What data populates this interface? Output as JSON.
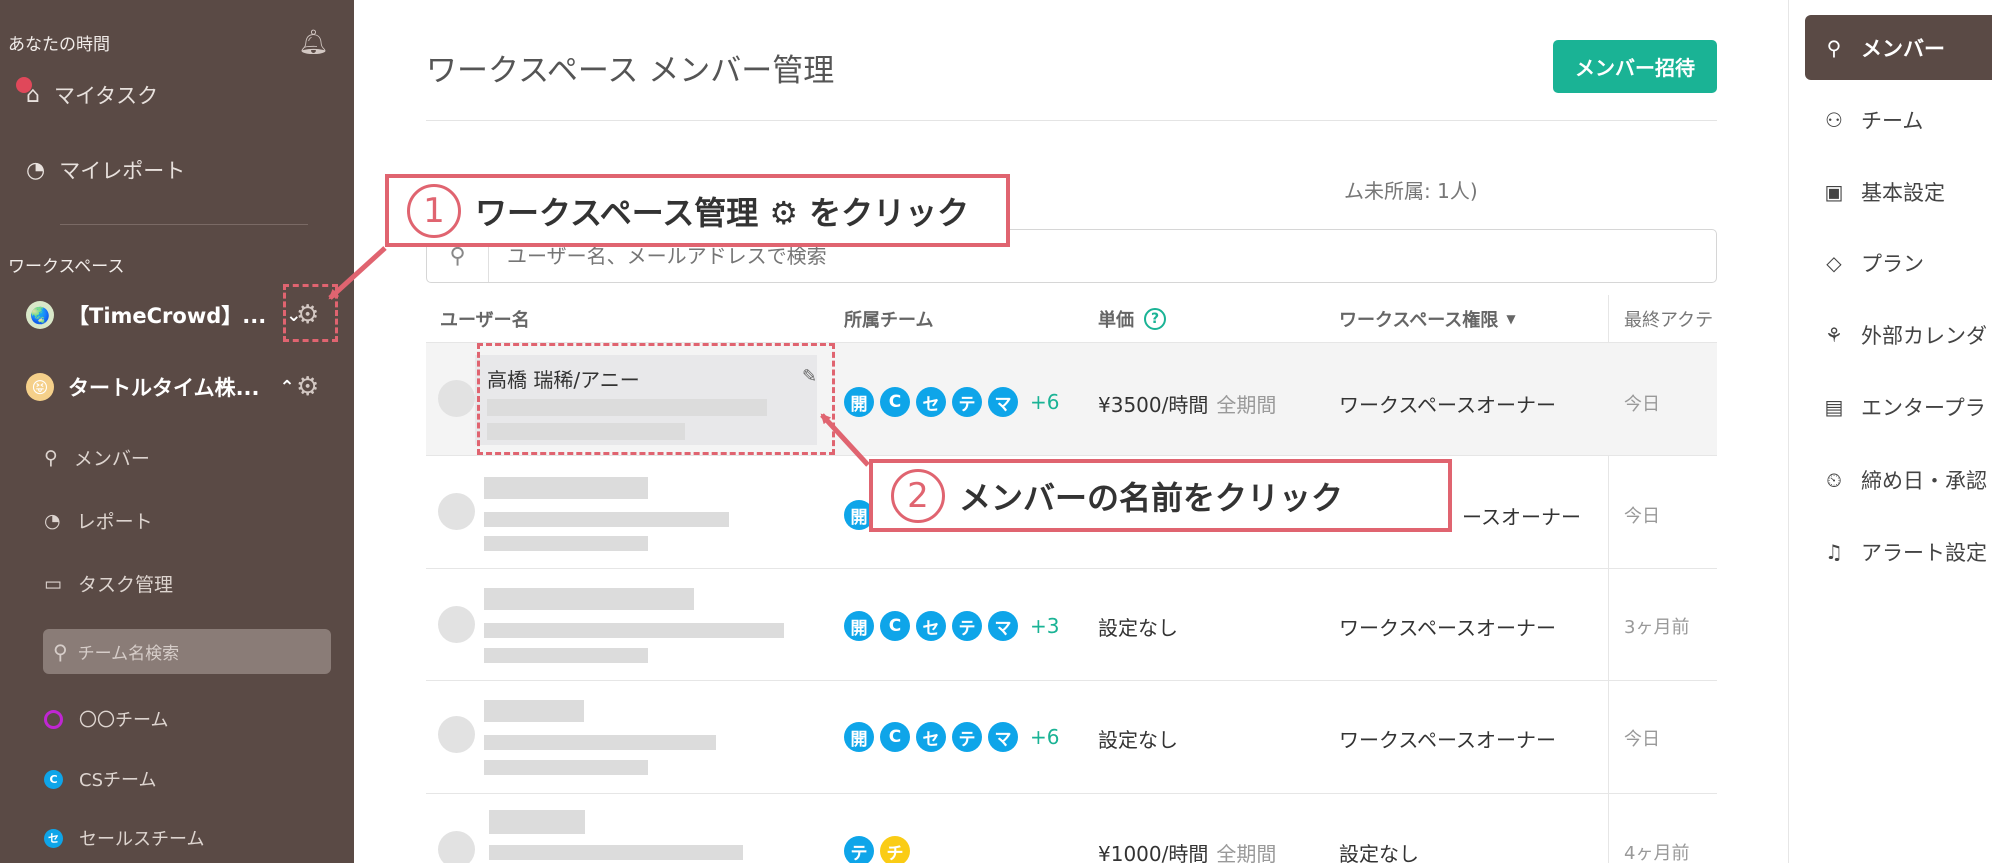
{
  "sidebar": {
    "your_time": "あなたの時間",
    "my_task": "マイタスク",
    "my_report": "マイレポート",
    "workspace_heading": "ワークスペース",
    "workspaces": [
      {
        "name": "【TimeCrowd】...",
        "avatar": "globe-avatar",
        "expanded": false
      },
      {
        "name": "タートルタイム株...",
        "avatar": "smile-avatar",
        "expanded": true
      }
    ],
    "sub_items": [
      "メンバー",
      "レポート",
      "タスク管理"
    ],
    "team_search_placeholder": "チーム名検索",
    "teams": [
      {
        "name": "〇〇チーム",
        "color": "#c026d3",
        "glyph": ""
      },
      {
        "name": "CSチーム",
        "color": "#0ea5e9",
        "glyph": "C"
      },
      {
        "name": "セールスチーム",
        "color": "#0ea5e9",
        "glyph": "セ"
      }
    ]
  },
  "main": {
    "title": "ワークスペース メンバー管理",
    "invite_button": "メンバー招待",
    "member_count_partial": "ム未所属: 1人)",
    "search_placeholder": "ユーザー名、メールアドレスで検索",
    "columns": [
      "ユーザー名",
      "所属チーム",
      "単価",
      "ワークスペース権限",
      "最終アクテ"
    ],
    "rows": [
      {
        "name": "高橋 瑞稀/アニー",
        "teams": [
          "開",
          "C",
          "セ",
          "テ",
          "マ"
        ],
        "team_more": "+6",
        "rate": "¥3500/時間",
        "rate_scope": "全期間",
        "role": "ワークスペースオーナー",
        "last_active": "今日"
      },
      {
        "name": "",
        "teams": [
          "開"
        ],
        "team_more": "",
        "rate": "",
        "rate_scope": "",
        "role": "ースオーナー",
        "last_active": "今日"
      },
      {
        "name": "",
        "teams": [
          "開",
          "C",
          "セ",
          "テ",
          "マ"
        ],
        "team_more": "+3",
        "rate": "設定なし",
        "rate_scope": "",
        "role": "ワークスペースオーナー",
        "last_active": "3ヶ月前"
      },
      {
        "name": "",
        "teams": [
          "開",
          "C",
          "セ",
          "テ",
          "マ"
        ],
        "team_more": "+6",
        "rate": "設定なし",
        "rate_scope": "",
        "role": "ワークスペースオーナー",
        "last_active": "今日"
      },
      {
        "name": "",
        "teams": [
          "テ",
          "チ"
        ],
        "team_more": "",
        "rate": "¥1000/時間",
        "rate_scope": "全期間",
        "role": "設定なし",
        "last_active": "4ヶ月前"
      }
    ],
    "team_colors": {
      "開": "#0ea5e9",
      "C": "#0ea5e9",
      "セ": "#0ea5e9",
      "テ": "#0ea5e9",
      "マ": "#0ea5e9",
      "チ": "#facc15"
    }
  },
  "right_panel": {
    "items": [
      {
        "label": "メンバー",
        "icon": "person-icon",
        "active": true
      },
      {
        "label": "チーム",
        "icon": "people-icon",
        "active": false
      },
      {
        "label": "基本設定",
        "icon": "box-icon",
        "active": false
      },
      {
        "label": "プラン",
        "icon": "diamond-icon",
        "active": false
      },
      {
        "label": "外部カレンダ",
        "icon": "hierarchy-icon",
        "active": false
      },
      {
        "label": "エンタープラ",
        "icon": "briefcase-icon",
        "active": false
      },
      {
        "label": "締め日・承認",
        "icon": "lock-clock-icon",
        "active": false
      },
      {
        "label": "アラート設定",
        "icon": "bell-icon",
        "active": false
      }
    ]
  },
  "annotations": {
    "step1_num": "1",
    "step1_text": "ワークスペース管理 ⚙ をクリック",
    "step2_num": "2",
    "step2_text": "メンバーの名前をクリック"
  },
  "colors": {
    "accent": "#1ab395",
    "sidebar": "#5a4a45",
    "annotation": "#e06470"
  }
}
